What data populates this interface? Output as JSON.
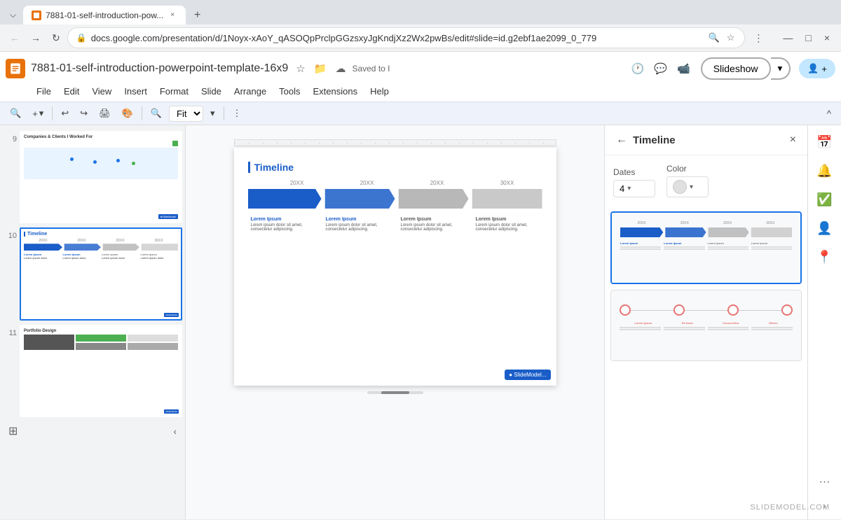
{
  "browser": {
    "tab_label": "7881-01-self-introduction-pow...",
    "tab_close": "×",
    "new_tab": "+",
    "nav_back": "←",
    "nav_forward": "→",
    "nav_refresh": "↻",
    "address": "docs.google.com/presentation/d/1Noyx-xAoY_qASOQpPrclpGGzsxyJgKndjXz2Wx2pwBs/edit#slide=id.g2ebf1ae2099_0_779",
    "zoom_in": "🔍",
    "bookmark": "☆",
    "options": "⋮",
    "minimize": "—",
    "maximize": "□",
    "close": "×"
  },
  "slides_app": {
    "doc_title": "7881-01-self-introduction-powerpoint-template-16x9",
    "saved_label": "Saved to I",
    "slideshow_btn": "Slideshow",
    "collab_icon": "👤+",
    "menu": [
      "File",
      "Edit",
      "View",
      "Insert",
      "Format",
      "Slide",
      "Arrange",
      "Tools",
      "Extensions",
      "Help"
    ]
  },
  "toolbar": {
    "zoom_btn": "🔍",
    "add_btn": "+",
    "undo": "↩",
    "redo": "↪",
    "print": "🖨",
    "paint": "🎨",
    "zoom_out": "🔍",
    "fit_label": "Fit",
    "more": "⋮",
    "collapse": "^"
  },
  "slide_panel": {
    "slides": [
      {
        "number": "9",
        "active": false
      },
      {
        "number": "10",
        "active": true
      },
      {
        "number": "11",
        "active": false
      }
    ]
  },
  "main_slide": {
    "title": "Timeline",
    "years": [
      "20XX",
      "20XX",
      "20XX",
      "30XX"
    ],
    "lorem_titles": [
      "Lorem Ipsum",
      "Lorem Ipsum",
      "Lorem Ipsum",
      "Lorem Ipsum"
    ],
    "lorem_texts": [
      "Lorem ipsum dolor sit amet, consectetur adipiscing.",
      "Lorem ipsum dolor sit amet, consectetur adipiscing.",
      "Lorem ipsum dolor sit amet, consectetur adipiscing.",
      "Lorem ipsum dolor sit amet, consectetur adipiscing."
    ],
    "logo": "● SlideModel..."
  },
  "right_panel": {
    "title": "Timeline",
    "back_btn": "←",
    "close_btn": "×",
    "dates_label": "Dates",
    "dates_value": "4",
    "color_label": "Color",
    "template1_type": "bar",
    "template2_type": "circles"
  },
  "right_sidebar": {
    "icons": [
      "📅",
      "🔔",
      "✅",
      "👤",
      "📍"
    ],
    "more": "···"
  },
  "watermark": "SLIDEMODEL.COM"
}
